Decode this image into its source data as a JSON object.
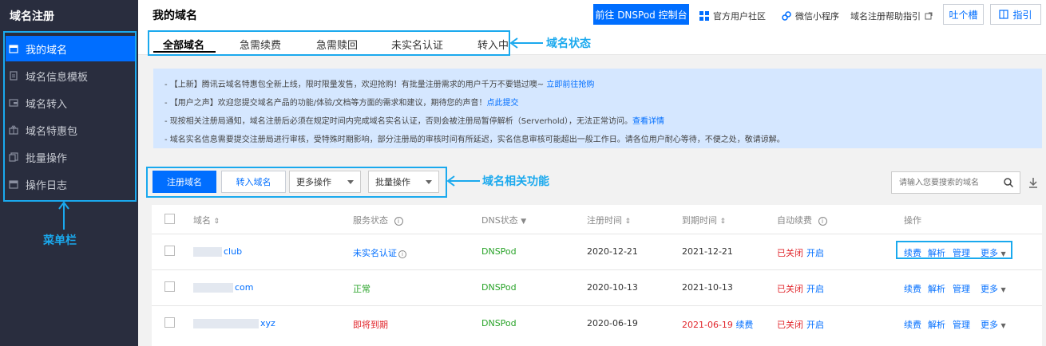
{
  "sidebar": {
    "title": "域名注册",
    "items": [
      {
        "label": "我的域名",
        "active": true
      },
      {
        "label": "域名信息模板"
      },
      {
        "label": "域名转入"
      },
      {
        "label": "域名特惠包"
      },
      {
        "label": "批量操作"
      },
      {
        "label": "操作日志"
      }
    ]
  },
  "header": {
    "title": "我的域名",
    "console_button": "前往 DNSPod 控制台",
    "links": [
      "官方用户社区",
      "微信小程序",
      "域名注册帮助指引"
    ],
    "feedback_button": "吐个槽",
    "guide_button": "指引"
  },
  "tabs": [
    "全部域名",
    "急需续费",
    "急需赎回",
    "未实名认证",
    "转入中"
  ],
  "annotations": {
    "tabs": "域名状态",
    "toolbar": "域名相关功能",
    "sidebar": "菜单栏"
  },
  "notices": [
    {
      "text": "- 【上新】腾讯云域名特惠包全新上线，限时限量发售，欢迎抢购！有批量注册需求的用户千万不要错过噢~ ",
      "link": "立即前往抢购"
    },
    {
      "text": "- 【用户之声】欢迎您提交域名产品的功能/体验/文档等方面的需求和建议，期待您的声音！",
      "link": "点此提交"
    },
    {
      "text": "- 现按相关注册局通知，域名注册后必须在规定时间内完成域名实名认证，否则会被注册局暂停解析（Serverhold），无法正常访问。",
      "link": "查看详情"
    },
    {
      "text": "- 域名实名信息需要提交注册局进行审核，受特殊时期影响，部分注册局的审核时间有所延迟，实名信息审核可能超出一般工作日。请各位用户耐心等待，不便之处，敬请谅解。",
      "link": ""
    }
  ],
  "toolbar": {
    "register": "注册域名",
    "transfer": "转入域名",
    "more_ops": "更多操作",
    "batch_ops": "批量操作",
    "search_placeholder": "请输入您要搜索的域名"
  },
  "table": {
    "headers": [
      "域名",
      "服务状态",
      "DNS状态",
      "注册时间",
      "到期时间",
      "自动续费",
      "操作"
    ],
    "rows": [
      {
        "domain": "club",
        "status": "未实名认证",
        "status_color": "#006eff",
        "dns": "DNSPod",
        "reg": "2020-12-21",
        "exp": "2021-12-21",
        "exp_extra": "",
        "auto": "已关闭",
        "auto_link": "开启",
        "actions": [
          "续费",
          "解析",
          "管理",
          "更多"
        ]
      },
      {
        "domain": "com",
        "status": "正常",
        "status_color": "#29a329",
        "dns": "DNSPod",
        "reg": "2020-10-13",
        "exp": "2021-10-13",
        "exp_extra": "",
        "auto": "已关闭",
        "auto_link": "开启",
        "actions": [
          "续费",
          "解析",
          "管理",
          "更多"
        ]
      },
      {
        "domain": "xyz",
        "status": "即将到期",
        "status_color": "#e1242a",
        "dns": "DNSPod",
        "reg": "2020-06-19",
        "exp": "2021-06-19",
        "exp_extra": "续费",
        "auto": "已关闭",
        "auto_link": "开启",
        "actions": [
          "续费",
          "解析",
          "管理",
          "更多"
        ]
      }
    ]
  },
  "colors": {
    "accent": "#006eff",
    "sidebar_bg": "#292d3e",
    "highlight": "#1aa9ee",
    "notice_bg": "#d5e7ff"
  }
}
